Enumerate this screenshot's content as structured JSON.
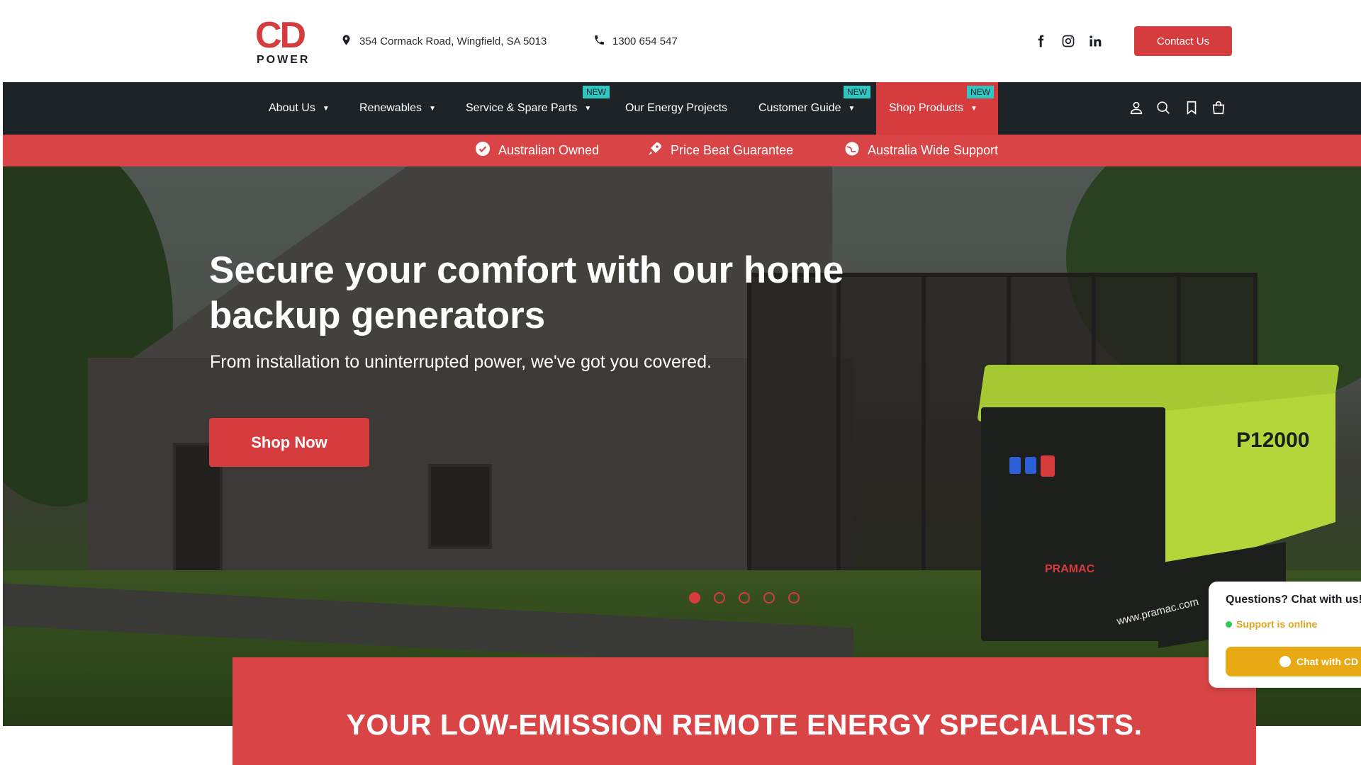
{
  "header": {
    "logo_top": "CD",
    "logo_bottom": "POWER",
    "address": "354 Cormack Road, Wingfield, SA 5013",
    "phone": "1300 654 547",
    "social_icons": [
      "facebook-icon",
      "instagram-icon",
      "linkedin-icon"
    ],
    "contact_button": "Contact Us"
  },
  "nav": {
    "items": [
      {
        "label": "About Us",
        "dropdown": true
      },
      {
        "label": "Renewables",
        "dropdown": true
      },
      {
        "label": "Service & Spare Parts",
        "dropdown": true,
        "badge": "NEW"
      },
      {
        "label": "Our Energy Projects",
        "dropdown": false
      },
      {
        "label": "Customer Guide",
        "dropdown": true,
        "badge": "NEW"
      },
      {
        "label": "Shop Products",
        "dropdown": true,
        "badge": "NEW",
        "active": true
      }
    ],
    "icons": [
      "account-icon",
      "search-icon",
      "bookmark-icon",
      "cart-icon"
    ]
  },
  "benefits": [
    {
      "label": "Australian Owned",
      "icon": "badge-check-icon"
    },
    {
      "label": "Price Beat Guarantee",
      "icon": "rocket-icon"
    },
    {
      "label": "Australia Wide Support",
      "icon": "globe-icon"
    }
  ],
  "hero": {
    "title": "Secure your comfort with our home backup generators",
    "subtitle": "From installation to uninterrupted power, we've got you covered.",
    "cta": "Shop Now",
    "slides_total": 5,
    "active_slide": 1,
    "generator_model": "P12000",
    "generator_brand": "PRAMAC",
    "generator_url": "www.pramac.com"
  },
  "banner": {
    "text": "YOUR LOW-EMISSION REMOTE ENERGY SPECIALISTS."
  },
  "chat": {
    "title": "Questions? Chat with us!",
    "status": "Support is online",
    "button": "Chat with CD"
  },
  "colors": {
    "brand_red": "#d63b3e",
    "nav_dark": "#1e2328",
    "badge_teal": "#2fc6c2",
    "chat_yellow": "#e8a914"
  }
}
